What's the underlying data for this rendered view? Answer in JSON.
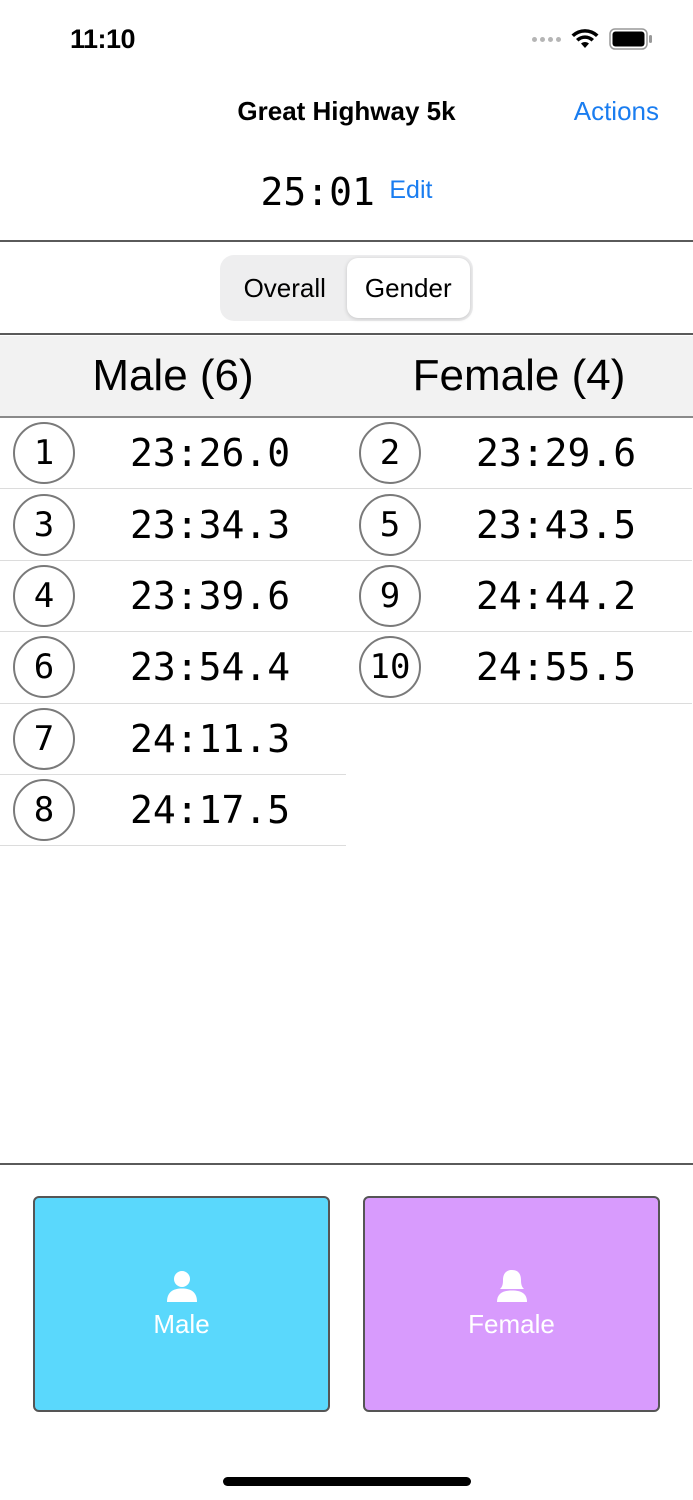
{
  "status_bar": {
    "time": "11:10"
  },
  "nav": {
    "title": "Great Highway 5k",
    "action_label": "Actions"
  },
  "clock": {
    "value": "25:01",
    "edit_label": "Edit"
  },
  "segments": {
    "items": [
      {
        "label": "Overall",
        "selected": false
      },
      {
        "label": "Gender",
        "selected": true
      }
    ]
  },
  "headers": {
    "male": "Male (6)",
    "female": "Female (4)"
  },
  "male_results": [
    {
      "place": "1",
      "time": "23:26.0"
    },
    {
      "place": "3",
      "time": "23:34.3"
    },
    {
      "place": "4",
      "time": "23:39.6"
    },
    {
      "place": "6",
      "time": "23:54.4"
    },
    {
      "place": "7",
      "time": "24:11.3"
    },
    {
      "place": "8",
      "time": "24:17.5"
    }
  ],
  "female_results": [
    {
      "place": "2",
      "time": "23:29.6"
    },
    {
      "place": "5",
      "time": "23:43.5"
    },
    {
      "place": "9",
      "time": "24:44.2"
    },
    {
      "place": "10",
      "time": "24:55.5"
    }
  ],
  "buttons": {
    "male": {
      "label": "Male",
      "color": "#5ad8fc",
      "icon": "male-person-icon"
    },
    "female": {
      "label": "Female",
      "color": "#d89bfd",
      "icon": "female-person-icon"
    }
  },
  "colors": {
    "accent": "#1a7df0"
  }
}
